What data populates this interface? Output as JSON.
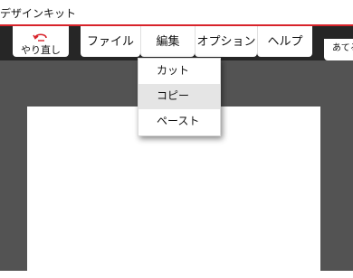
{
  "window": {
    "title": "デザインキット"
  },
  "toolbar": {
    "undo_label": "やり直し",
    "more_label": "あてる"
  },
  "menubar": {
    "items": [
      {
        "label": "ファイル"
      },
      {
        "label": "編集"
      },
      {
        "label": "オプション"
      },
      {
        "label": "ヘルプ"
      }
    ]
  },
  "edit_menu": {
    "items": [
      {
        "label": "カット"
      },
      {
        "label": "コピー"
      },
      {
        "label": "ペースト"
      }
    ],
    "hovered": "コピー"
  },
  "colors": {
    "accent": "#d8232a",
    "toolbar_bg": "#262626",
    "workspace_bg": "#535353"
  }
}
